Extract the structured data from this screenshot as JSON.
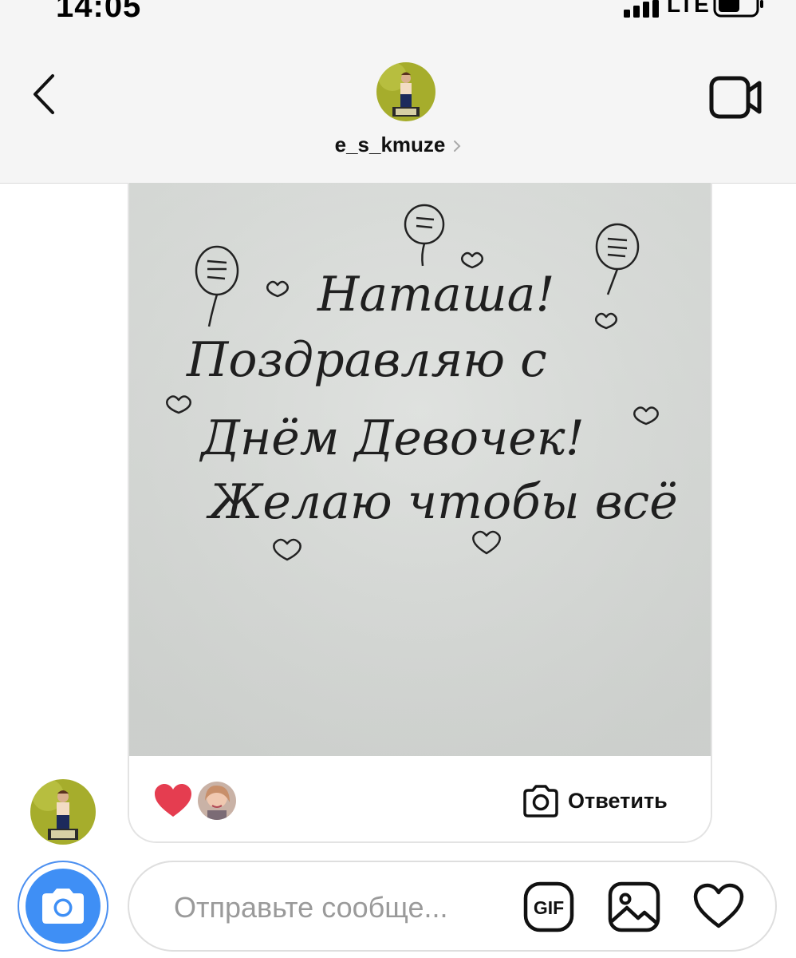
{
  "status_bar": {
    "time": "14:05",
    "network": "LTE",
    "icons": [
      "signal-icon",
      "battery-icon"
    ]
  },
  "header": {
    "username": "e_s_kmuze",
    "icons": [
      "chevron-left-icon",
      "video-camera-icon",
      "chevron-right-icon"
    ]
  },
  "message": {
    "photo_text": {
      "line1": "Наташа!",
      "line2": "Поздравляю с",
      "line3": "Днём Девочек!",
      "line4": "Желаю чтобы всё"
    },
    "reactions": {
      "emoji": "❤",
      "heart_color": "#e53d50"
    },
    "reply_label": "Ответить",
    "icons": [
      "camera-icon"
    ]
  },
  "composer": {
    "placeholder": "Отправьте сообще...",
    "gif_label": "GIF",
    "camera_color": "#3f8ff5",
    "icons": [
      "camera-icon",
      "gif-icon",
      "image-icon",
      "heart-outline-icon"
    ]
  }
}
